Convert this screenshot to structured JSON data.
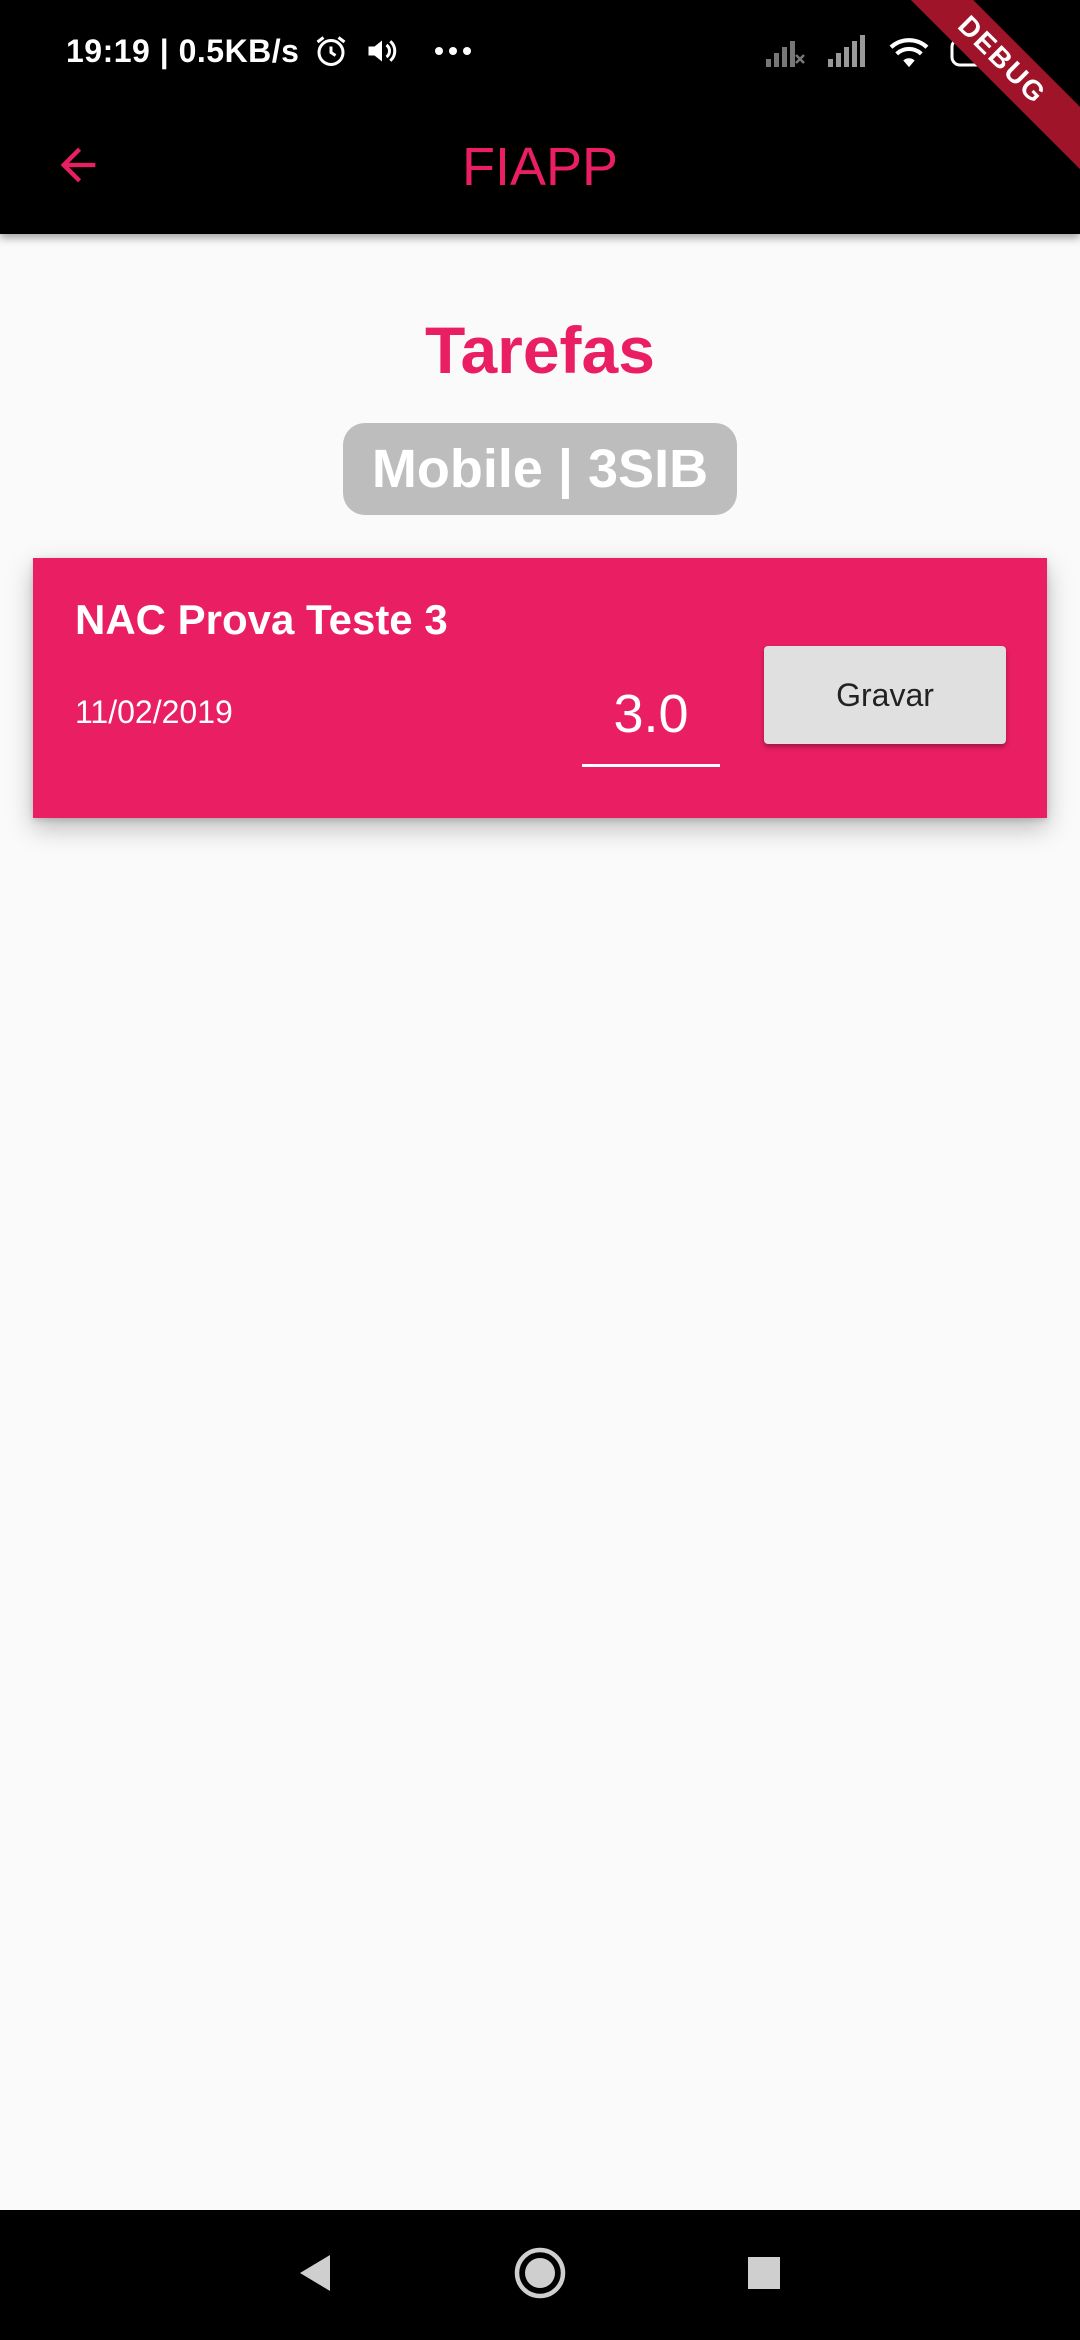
{
  "status_bar": {
    "time_speed": "19:19 | 0.5KB/s",
    "left_icons": [
      "alarm-icon",
      "volume-icon",
      "more-dots-icon"
    ],
    "right_icons": [
      "signal-off-icon",
      "signal-icon",
      "wifi-icon",
      "battery-charging-icon"
    ]
  },
  "debug_banner": "DEBUG",
  "app_bar": {
    "title": "FIAPP",
    "back_icon": "arrow-left-icon"
  },
  "page": {
    "title": "Tarefas",
    "course_chip": "Mobile | 3SIB"
  },
  "tasks": [
    {
      "name": "NAC Prova Teste 3",
      "date": "11/02/2019",
      "grade": "3.0",
      "save_label": "Gravar"
    }
  ],
  "nav_bar": {
    "buttons": [
      "back-triangle-icon",
      "home-circle-icon",
      "recents-square-icon"
    ]
  },
  "colors": {
    "accent": "#e91e63",
    "app_bar": "#000000",
    "background": "#fafafa",
    "chip": "#bdbdbd",
    "button": "#e0e0e0"
  }
}
